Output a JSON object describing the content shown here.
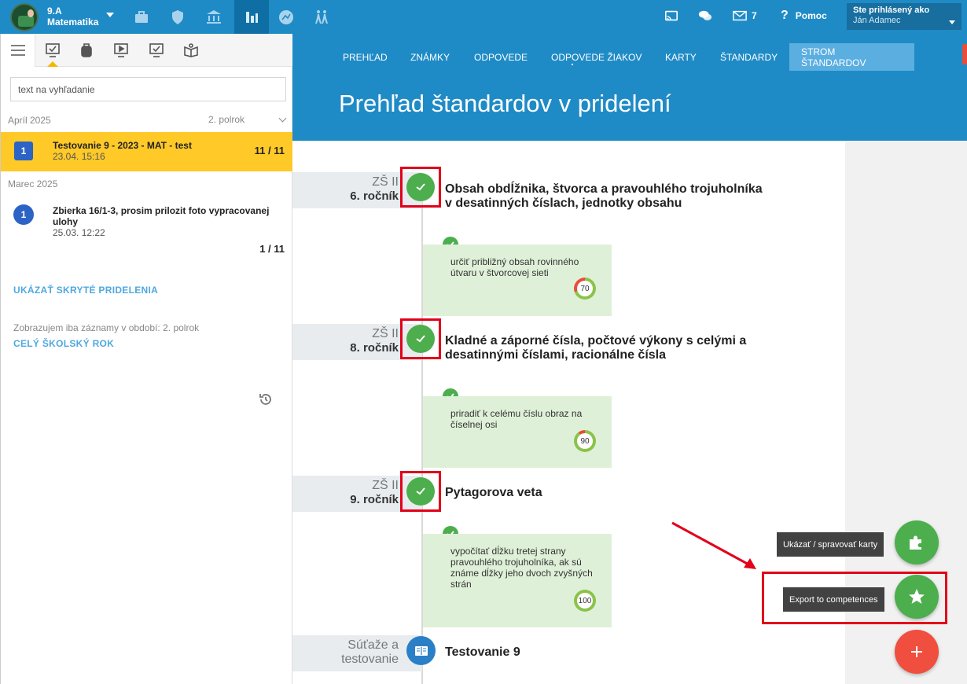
{
  "topbar": {
    "class_name": "9.A",
    "subject": "Matematika",
    "messages_count": "7",
    "help_label": "Pomoc",
    "user_label": "Ste prihlásený ako",
    "user_name": "Ján Adamec",
    "accent": "#1f8bc6"
  },
  "sidebar": {
    "search_placeholder": "text na vyhľadanie",
    "period_label": "2. polrok",
    "groups": [
      {
        "month": "Apríl 2025"
      },
      {
        "month": "Marec 2025"
      }
    ],
    "assignments": [
      {
        "badge": "1",
        "title": "Testovanie 9 - 2023 - MAT - test",
        "date": "23.04. 15:16",
        "count": "11 / 11"
      },
      {
        "badge": "1",
        "title_line1": "Zbierka 16/1-3, prosim prilozit foto vypracovanej",
        "title_line2": "ulohy",
        "date": "25.03. 12:22",
        "count": "1 / 11"
      }
    ],
    "show_hidden_link": "UKÁZAŤ SKRYTÉ PRIDELENIA",
    "period_note": "Zobrazujem iba záznamy v období: 2. polrok",
    "whole_year_link": "CELÝ ŠKOLSKÝ ROK"
  },
  "main": {
    "tabs": [
      "PREHĽAD",
      "ZNÁMKY",
      "ODPOVEDE",
      "ODPOVEDE ŽIAKOV",
      "KARTY",
      "ŠTANDARDY",
      "STROM ŠTANDARDOV"
    ],
    "page_title": "Prehľad štandardov v pridelení",
    "sections": [
      {
        "grade_top": "ZŠ II",
        "grade_bottom": "6. ročník",
        "topic_line1": "Obsah obdĺžnika, štvorca a pravouhlého trojuholníka",
        "topic_line2": "v desatinných číslach, jednotky obsahu",
        "standard_line1": "určiť približný obsah rovinného",
        "standard_line2": "útvaru v štvorcovej sieti",
        "score": "70",
        "score_value": 70
      },
      {
        "grade_top": "ZŠ II",
        "grade_bottom": "8. ročník",
        "topic_line1": "Kladné a záporné čísla, počtové výkony s celými a",
        "topic_line2": "desatinnými číslami, racionálne čísla",
        "standard_line1": "priradiť k celému číslu obraz na",
        "standard_line2": "číselnej osi",
        "score": "90",
        "score_value": 90
      },
      {
        "grade_top": "ZŠ II",
        "grade_bottom": "9. ročník",
        "topic_line1": "Pytagorova veta",
        "standard_line1": "vypočítať dĺžku tretej strany",
        "standard_line2": "pravouhlého trojuholníka, ak sú",
        "standard_line3": "známe dĺžky jeho dvoch zvyšných",
        "standard_line4": "strán",
        "score": "100",
        "score_value": 100
      },
      {
        "grade_top": "Súťaže a",
        "grade_bottom": "testovanie",
        "topic_line1": "Testovanie 9"
      }
    ]
  },
  "fabs": {
    "cards_label": "Ukázať / spravovať karty",
    "export_label": "Export to competences"
  }
}
